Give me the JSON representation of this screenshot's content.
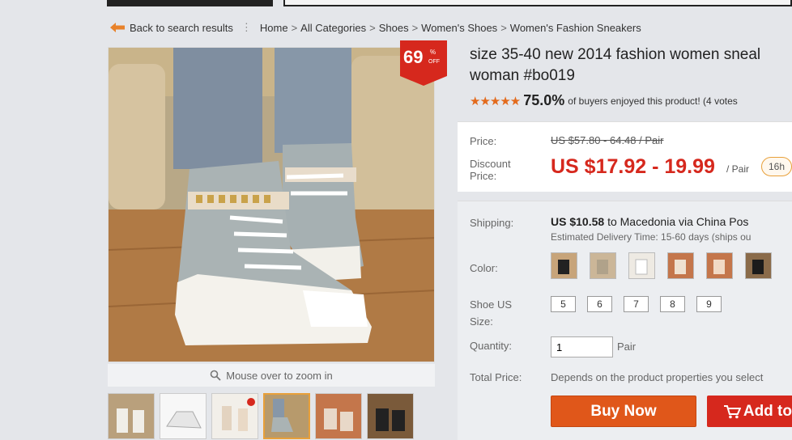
{
  "breadcrumb": {
    "back": "Back to search results",
    "items": [
      "Home",
      "All Categories",
      "Shoes",
      "Women's Shoes",
      "Women's Fashion Sneakers"
    ]
  },
  "badge": {
    "number": "69",
    "pct": "%",
    "off": "OFF"
  },
  "gallery": {
    "zoom_hint": "Mouse over to zoom in"
  },
  "product": {
    "title_line1": "size 35-40 new 2014 fashion women sneal",
    "title_line2": "woman #bo019",
    "stars": "★★★★★",
    "rating_pct": "75.0%",
    "rating_text": "of buyers enjoyed this product! (4 votes"
  },
  "price": {
    "price_label": "Price:",
    "old_price": "US $57.80 - 64.48 / Pair",
    "discount_label_1": "Discount",
    "discount_label_2": "Price:",
    "discount_price": "US $17.92 - 19.99",
    "per_unit": "/ Pair",
    "timer": "16h"
  },
  "shipping": {
    "label": "Shipping:",
    "cost": "US $10.58",
    "to_text": "to Macedonia via China Pos",
    "delivery": "Estimated Delivery Time: 15-60 days (ships ou"
  },
  "color": {
    "label": "Color:"
  },
  "size": {
    "label_1": "Shoe US",
    "label_2": "Size:",
    "options": [
      "5",
      "6",
      "7",
      "8",
      "9"
    ]
  },
  "quantity": {
    "label": "Quantity:",
    "value": "1",
    "unit": "Pair"
  },
  "total": {
    "label": "Total Price:",
    "value": "Depends on the product properties you select"
  },
  "actions": {
    "buy_now": "Buy Now",
    "add_to_cart": "Add to"
  },
  "colors": {
    "accent": "#e0571a",
    "price_red": "#d6281d"
  }
}
